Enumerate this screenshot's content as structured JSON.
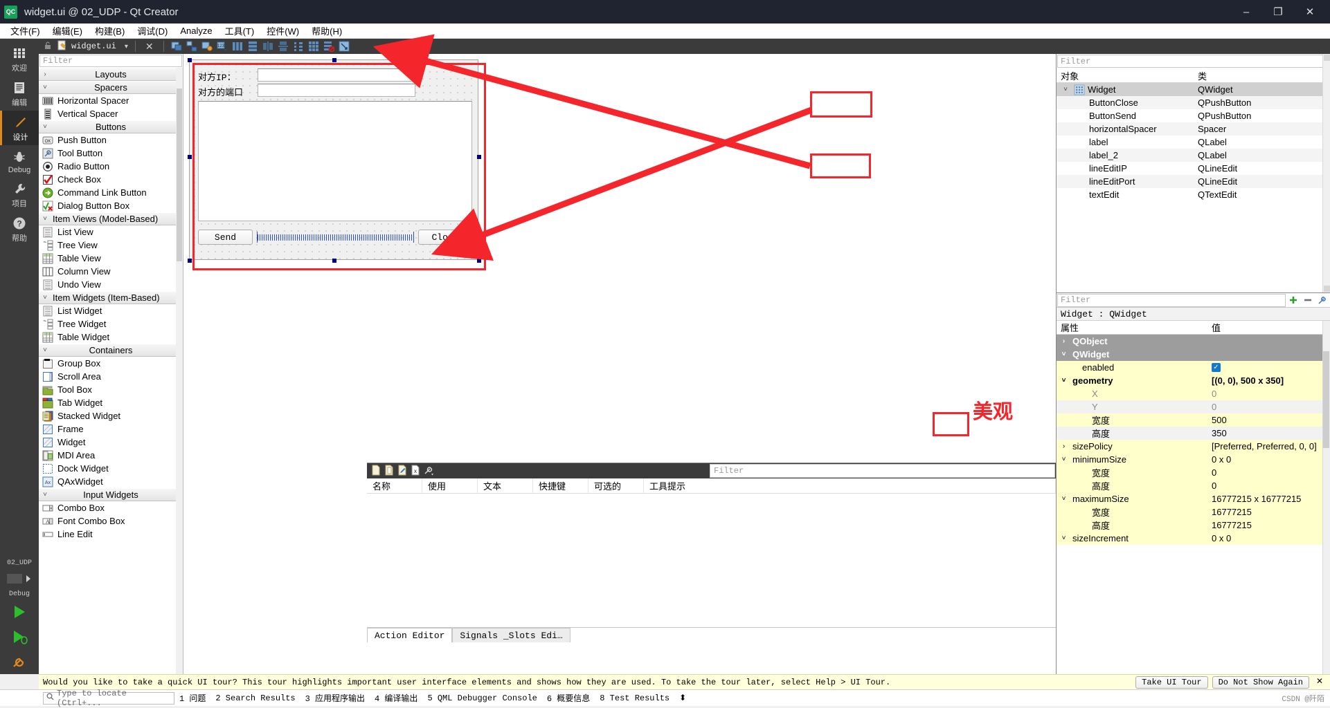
{
  "window": {
    "title": "widget.ui @ 02_UDP - Qt Creator",
    "logo_text": "QC",
    "minimize": "–",
    "maximize": "❐",
    "close": "✕"
  },
  "menubar": [
    {
      "label": "文件(F)",
      "mnemonic": "F"
    },
    {
      "label": "编辑(E)",
      "mnemonic": "E"
    },
    {
      "label": "构建(B)",
      "mnemonic": "B"
    },
    {
      "label": "调试(D)",
      "mnemonic": "D"
    },
    {
      "label": "Analyze",
      "mnemonic": "A"
    },
    {
      "label": "工具(T)",
      "mnemonic": "T"
    },
    {
      "label": "控件(W)",
      "mnemonic": "W"
    },
    {
      "label": "帮助(H)",
      "mnemonic": "H"
    }
  ],
  "rail": {
    "items": [
      {
        "label": "欢迎",
        "icon": "grid-icon"
      },
      {
        "label": "编辑",
        "icon": "document-icon"
      },
      {
        "label": "设计",
        "icon": "pencil-icon",
        "active": true
      },
      {
        "label": "Debug",
        "icon": "bug-icon"
      },
      {
        "label": "项目",
        "icon": "wrench-icon"
      },
      {
        "label": "帮助",
        "icon": "question-icon"
      }
    ],
    "kit_name": "02_UDP",
    "kit_mode": "Debug"
  },
  "docbar": {
    "tab_name": "widget.ui",
    "dropdown": "▾",
    "close": "✕",
    "tools": [
      "edit-widgets-icon",
      "edit-signals-icon",
      "edit-buddies-icon",
      "edit-taborder-icon",
      "layout-horizontal-icon",
      "layout-vertical-icon",
      "layout-splitter-h-icon",
      "layout-splitter-v-icon",
      "layout-form-icon",
      "layout-grid-icon",
      "break-layout-icon",
      "adjust-size-icon"
    ]
  },
  "widgetbox": {
    "filter_placeholder": "Filter",
    "groups": [
      {
        "name": "Layouts",
        "expanded": false,
        "items": []
      },
      {
        "name": "Spacers",
        "expanded": true,
        "items": [
          {
            "label": "Horizontal Spacer",
            "icon": "hspacer-icon"
          },
          {
            "label": "Vertical Spacer",
            "icon": "vspacer-icon"
          }
        ]
      },
      {
        "name": "Buttons",
        "expanded": true,
        "items": [
          {
            "label": "Push Button",
            "icon": "pushbutton-icon"
          },
          {
            "label": "Tool Button",
            "icon": "toolbutton-icon"
          },
          {
            "label": "Radio Button",
            "icon": "radiobutton-icon"
          },
          {
            "label": "Check Box",
            "icon": "checkbox-icon"
          },
          {
            "label": "Command Link Button",
            "icon": "commandlink-icon"
          },
          {
            "label": "Dialog Button Box",
            "icon": "dialogbuttonbox-icon"
          }
        ]
      },
      {
        "name": "Item Views (Model-Based)",
        "expanded": true,
        "align": "left",
        "items": [
          {
            "label": "List View",
            "icon": "listview-icon"
          },
          {
            "label": "Tree View",
            "icon": "treeview-icon"
          },
          {
            "label": "Table View",
            "icon": "tableview-icon"
          },
          {
            "label": "Column View",
            "icon": "columnview-icon"
          },
          {
            "label": "Undo View",
            "icon": "undoview-icon"
          }
        ]
      },
      {
        "name": "Item Widgets (Item-Based)",
        "expanded": true,
        "align": "left",
        "items": [
          {
            "label": "List Widget",
            "icon": "listwidget-icon"
          },
          {
            "label": "Tree Widget",
            "icon": "treewidget-icon"
          },
          {
            "label": "Table Widget",
            "icon": "tablewidget-icon"
          }
        ]
      },
      {
        "name": "Containers",
        "expanded": true,
        "items": [
          {
            "label": "Group Box",
            "icon": "groupbox-icon"
          },
          {
            "label": "Scroll Area",
            "icon": "scrollarea-icon"
          },
          {
            "label": "Tool Box",
            "icon": "toolbox-icon"
          },
          {
            "label": "Tab Widget",
            "icon": "tabwidget-icon"
          },
          {
            "label": "Stacked Widget",
            "icon": "stackedwidget-icon"
          },
          {
            "label": "Frame",
            "icon": "frame-icon"
          },
          {
            "label": "Widget",
            "icon": "widget-icon"
          },
          {
            "label": "MDI Area",
            "icon": "mdiarea-icon"
          },
          {
            "label": "Dock Widget",
            "icon": "dockwidget-icon"
          },
          {
            "label": "QAxWidget",
            "icon": "qaxwidget-icon"
          }
        ]
      },
      {
        "name": "Input Widgets",
        "expanded": true,
        "items": [
          {
            "label": "Combo Box",
            "icon": "combobox-icon"
          },
          {
            "label": "Font Combo Box",
            "icon": "fontcombobox-icon"
          },
          {
            "label": "Line Edit",
            "icon": "lineedit-icon"
          }
        ]
      }
    ]
  },
  "form": {
    "label_ip": "对方IP：",
    "label_port": "对方的端口",
    "lineedit_ip_value": "",
    "lineedit_port_value": "",
    "textedit_value": "",
    "button_send": "Send",
    "button_close": "Close",
    "spacer_name": "horizontalSpacer"
  },
  "object_inspector": {
    "filter_placeholder": "Filter",
    "columns": [
      "对象",
      "类"
    ],
    "rows": [
      {
        "name": "Widget",
        "class": "QWidget",
        "indent": 0,
        "expanded": true,
        "selected": true,
        "icon": "widget-icon"
      },
      {
        "name": "ButtonClose",
        "class": "QPushButton",
        "indent": 1,
        "highlight": true
      },
      {
        "name": "ButtonSend",
        "class": "QPushButton",
        "indent": 1,
        "highlight": true
      },
      {
        "name": "horizontalSpacer",
        "class": "Spacer",
        "indent": 1
      },
      {
        "name": "label",
        "class": "QLabel",
        "indent": 1
      },
      {
        "name": "label_2",
        "class": "QLabel",
        "indent": 1
      },
      {
        "name": "lineEditIP",
        "class": "QLineEdit",
        "indent": 1,
        "highlight": true
      },
      {
        "name": "lineEditPort",
        "class": "QLineEdit",
        "indent": 1,
        "highlight": true
      },
      {
        "name": "textEdit",
        "class": "QTextEdit",
        "indent": 1
      }
    ]
  },
  "property_editor": {
    "filter_placeholder": "Filter",
    "object_line": "Widget : QWidget",
    "columns": [
      "属性",
      "值"
    ],
    "buttons": [
      "add-property-icon",
      "remove-property-icon",
      "configure-icon"
    ],
    "rows": [
      {
        "key": "QObject",
        "value": "",
        "type": "group",
        "chev": "›"
      },
      {
        "key": "QWidget",
        "value": "",
        "type": "group",
        "chev": "˅"
      },
      {
        "key": "enabled",
        "value": "",
        "type": "check",
        "checked": true,
        "indent": 1
      },
      {
        "key": "geometry",
        "value": "[(0, 0), 500 x 350]",
        "type": "bold",
        "chev": "˅",
        "indent": 0
      },
      {
        "key": "X",
        "value": "0",
        "type": "sub",
        "dim": true,
        "indent": 2
      },
      {
        "key": "Y",
        "value": "0",
        "type": "sub",
        "dim": true,
        "indent": 2,
        "alt": true
      },
      {
        "key": "宽度",
        "value": "500",
        "type": "sub",
        "indent": 2,
        "highlight": true
      },
      {
        "key": "高度",
        "value": "350",
        "type": "sub",
        "indent": 2,
        "alt": true,
        "highlight": true
      },
      {
        "key": "sizePolicy",
        "value": "[Preferred, Preferred, 0, 0]",
        "chev": "›",
        "indent": 0
      },
      {
        "key": "minimumSize",
        "value": "0 x 0",
        "chev": "˅",
        "indent": 0
      },
      {
        "key": "宽度",
        "value": "0",
        "type": "sub",
        "indent": 2
      },
      {
        "key": "高度",
        "value": "0",
        "type": "sub",
        "indent": 2
      },
      {
        "key": "maximumSize",
        "value": "16777215 x 16777215",
        "chev": "˅",
        "indent": 0
      },
      {
        "key": "宽度",
        "value": "16777215",
        "type": "sub",
        "indent": 2
      },
      {
        "key": "高度",
        "value": "16777215",
        "type": "sub",
        "indent": 2
      },
      {
        "key": "sizeIncrement",
        "value": "0 x 0",
        "chev": "˅",
        "indent": 0
      }
    ]
  },
  "action_editor": {
    "filter_placeholder": "Filter",
    "toolbar_icons": [
      "new-action-icon",
      "copy-action-icon",
      "edit-action-icon",
      "delete-action-icon",
      "configure-action-icon"
    ],
    "columns": [
      "名称",
      "使用",
      "文本",
      "快捷键",
      "可选的",
      "工具提示"
    ],
    "tabs": [
      {
        "label": "Action Editor",
        "active": true
      },
      {
        "label": "Signals _Slots Edi…",
        "active": false
      }
    ]
  },
  "infobar": {
    "message": "Would you like to take a quick UI tour? This tour highlights important user interface elements and shows how they are used. To take the tour later, select Help > UI Tour.",
    "take_tour": "Take UI Tour",
    "do_not_show": "Do Not Show Again",
    "close": "✕"
  },
  "statusbar": {
    "locator_placeholder": "Type to locate (Ctrl+...",
    "items": [
      "1 问题",
      "2 Search Results",
      "3 应用程序输出",
      "4 编译输出",
      "5 QML Debugger Console",
      "6 概要信息",
      "8 Test Results"
    ],
    "more": "⬍",
    "watermark": "CSDN @阡陌"
  },
  "annotations": {
    "note_text": "美观",
    "note_color": "#f4262c",
    "highlight_color": "#f4262c"
  }
}
